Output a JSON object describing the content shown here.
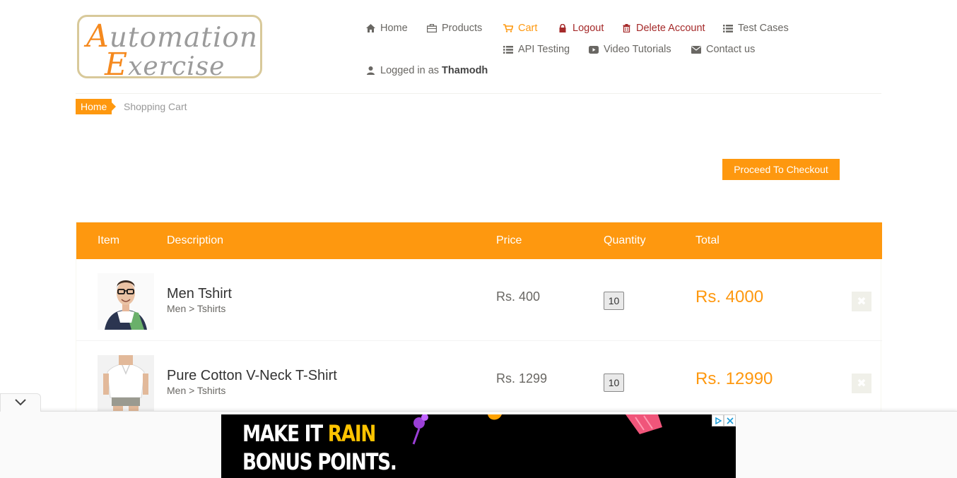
{
  "logo": {
    "line1_cap": "A",
    "line1_rest": "utomation",
    "line2_cap": "E",
    "line2_rest": "xercise"
  },
  "nav": {
    "home": "Home",
    "products": "Products",
    "cart": "Cart",
    "logout": "Logout",
    "delete_account": "Delete Account",
    "test_cases": "Test Cases",
    "api_testing": "API Testing",
    "video_tutorials": "Video Tutorials",
    "contact_us": "Contact us",
    "logged_in_prefix": "Logged in as",
    "username": "Thamodh"
  },
  "breadcrumb": {
    "home": "Home",
    "current": "Shopping Cart"
  },
  "checkout_button": "Proceed To Checkout",
  "table": {
    "headers": {
      "item": "Item",
      "description": "Description",
      "price": "Price",
      "quantity": "Quantity",
      "total": "Total"
    },
    "rows": [
      {
        "name": "Men Tshirt",
        "category": "Men > Tshirts",
        "price": "Rs. 400",
        "quantity": "10",
        "total": "Rs. 4000"
      },
      {
        "name": "Pure Cotton V-Neck T-Shirt",
        "category": "Men > Tshirts",
        "price": "Rs. 1299",
        "quantity": "10",
        "total": "Rs. 12990"
      }
    ]
  },
  "ad": {
    "line1_a": "MAKE IT ",
    "line1_b": "RAIN",
    "line2": "BONUS POINTS."
  },
  "colors": {
    "accent": "#fe980f",
    "danger": "#a52a2a",
    "text": "#696763"
  }
}
